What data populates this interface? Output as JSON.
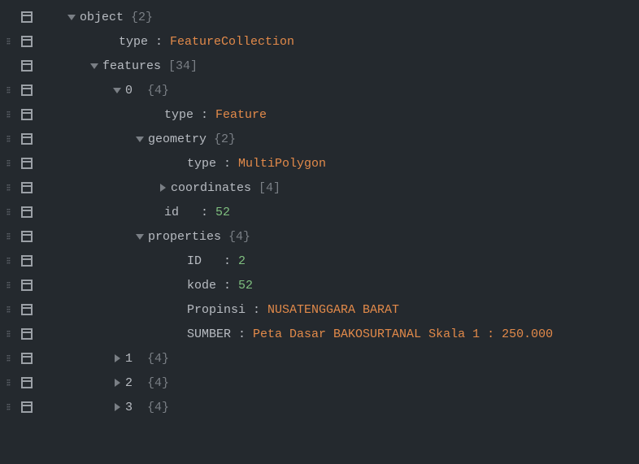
{
  "rows": [
    {
      "grip": false,
      "indent": 32,
      "toggle": "down",
      "segments": [
        {
          "cls": "key",
          "text": "object "
        },
        {
          "cls": "meta",
          "text": "{2}"
        }
      ]
    },
    {
      "grip": true,
      "indent": 80,
      "toggle": null,
      "segments": [
        {
          "cls": "key",
          "text": "type"
        },
        {
          "cls": "colon",
          "text": " : "
        },
        {
          "cls": "string",
          "text": "FeatureCollection"
        }
      ]
    },
    {
      "grip": false,
      "indent": 60,
      "toggle": "down",
      "segments": [
        {
          "cls": "key",
          "text": "features "
        },
        {
          "cls": "meta",
          "text": "[34]"
        }
      ]
    },
    {
      "grip": true,
      "indent": 88,
      "toggle": "down",
      "segments": [
        {
          "cls": "idx",
          "text": "0  "
        },
        {
          "cls": "meta",
          "text": "{4}"
        }
      ]
    },
    {
      "grip": true,
      "indent": 136,
      "toggle": null,
      "segments": [
        {
          "cls": "key",
          "text": "type"
        },
        {
          "cls": "colon",
          "text": " : "
        },
        {
          "cls": "string",
          "text": "Feature"
        }
      ]
    },
    {
      "grip": true,
      "indent": 116,
      "toggle": "down",
      "segments": [
        {
          "cls": "key",
          "text": "geometry "
        },
        {
          "cls": "meta",
          "text": "{2}"
        }
      ]
    },
    {
      "grip": true,
      "indent": 164,
      "toggle": null,
      "segments": [
        {
          "cls": "key",
          "text": "type"
        },
        {
          "cls": "colon",
          "text": " : "
        },
        {
          "cls": "string",
          "text": "MultiPolygon"
        }
      ]
    },
    {
      "grip": true,
      "indent": 144,
      "toggle": "right",
      "segments": [
        {
          "cls": "key",
          "text": "coordinates "
        },
        {
          "cls": "meta",
          "text": "[4]"
        }
      ]
    },
    {
      "grip": true,
      "indent": 136,
      "toggle": null,
      "segments": [
        {
          "cls": "key",
          "text": "id  "
        },
        {
          "cls": "colon",
          "text": " : "
        },
        {
          "cls": "number",
          "text": "52"
        }
      ]
    },
    {
      "grip": true,
      "indent": 116,
      "toggle": "down",
      "segments": [
        {
          "cls": "key",
          "text": "properties "
        },
        {
          "cls": "meta",
          "text": "{4}"
        }
      ]
    },
    {
      "grip": true,
      "indent": 164,
      "toggle": null,
      "segments": [
        {
          "cls": "key",
          "text": "ID  "
        },
        {
          "cls": "colon",
          "text": " : "
        },
        {
          "cls": "number",
          "text": "2"
        }
      ]
    },
    {
      "grip": true,
      "indent": 164,
      "toggle": null,
      "segments": [
        {
          "cls": "key",
          "text": "kode"
        },
        {
          "cls": "colon",
          "text": " : "
        },
        {
          "cls": "number",
          "text": "52"
        }
      ]
    },
    {
      "grip": true,
      "indent": 164,
      "toggle": null,
      "segments": [
        {
          "cls": "key",
          "text": "Propinsi"
        },
        {
          "cls": "colon",
          "text": " : "
        },
        {
          "cls": "string",
          "text": "NUSATENGGARA BARAT"
        }
      ]
    },
    {
      "grip": true,
      "indent": 164,
      "toggle": null,
      "segments": [
        {
          "cls": "key",
          "text": "SUMBER"
        },
        {
          "cls": "colon",
          "text": " : "
        },
        {
          "cls": "string",
          "text": "Peta Dasar BAKOSURTANAL Skala 1 : 250.000"
        }
      ]
    },
    {
      "grip": true,
      "indent": 88,
      "toggle": "right",
      "segments": [
        {
          "cls": "idx",
          "text": "1  "
        },
        {
          "cls": "meta",
          "text": "{4}"
        }
      ]
    },
    {
      "grip": true,
      "indent": 88,
      "toggle": "right",
      "segments": [
        {
          "cls": "idx",
          "text": "2  "
        },
        {
          "cls": "meta",
          "text": "{4}"
        }
      ]
    },
    {
      "grip": true,
      "indent": 88,
      "toggle": "right",
      "segments": [
        {
          "cls": "idx",
          "text": "3  "
        },
        {
          "cls": "meta",
          "text": "{4}"
        }
      ]
    }
  ]
}
